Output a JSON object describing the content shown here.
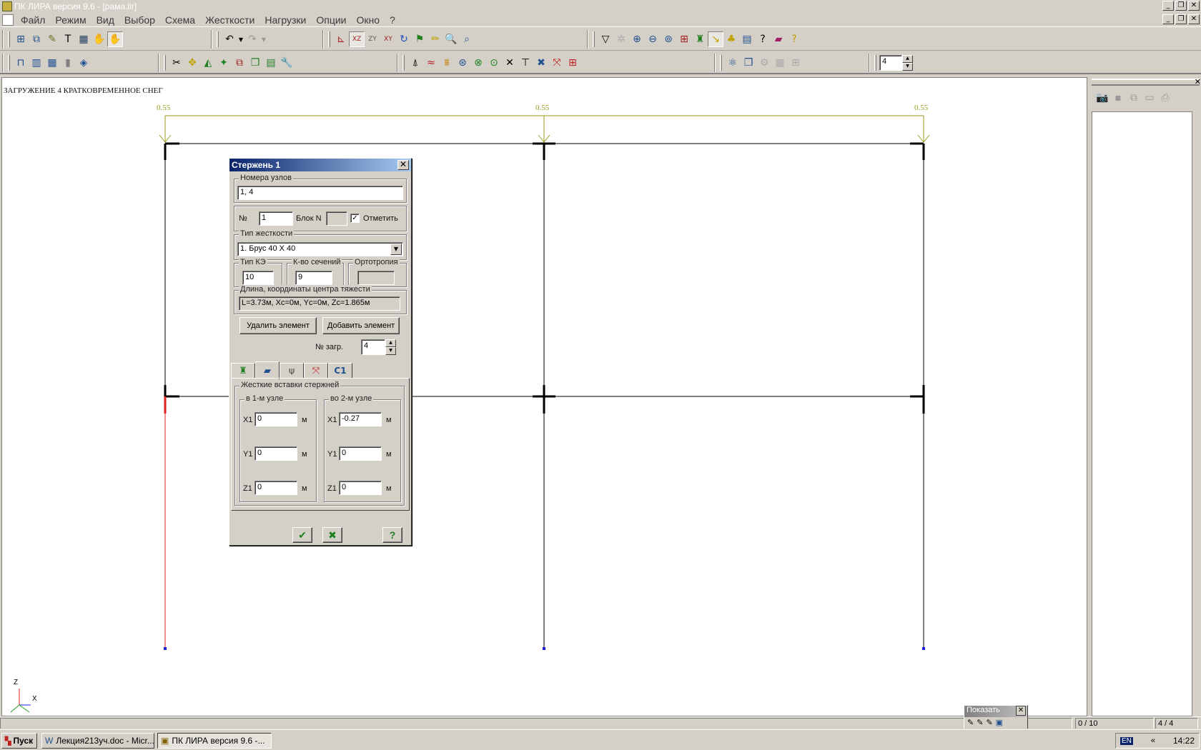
{
  "window": {
    "title": "ПК ЛИРА  версия 9.6 - [рама.lir]"
  },
  "menu": [
    "Файл",
    "Режим",
    "Вид",
    "Выбор",
    "Схема",
    "Жесткости",
    "Нагрузки",
    "Опции",
    "Окно",
    "?"
  ],
  "toolbar2": {
    "spin_value": "4"
  },
  "canvas": {
    "load_title": "ЗАГРУЖЕНИЕ 4 КРАТКОВРЕМЕННОЕ СНЕГ",
    "load_labels": [
      "0.55",
      "0.55",
      "0.55"
    ],
    "axis_z": "Z",
    "axis_x": "X"
  },
  "dialog": {
    "title": "Стержень  1",
    "nodes_legend": "Номера узлов",
    "nodes_value": "1, 4",
    "num_label": "№",
    "num_value": "1",
    "block_label": "Блок N",
    "mark_label": "Отметить",
    "mark_checked": true,
    "stiff_legend": "Тип жесткости",
    "stiff_value": "1. Брус 40 X 40",
    "fe_legend": "Тип КЭ",
    "fe_value": "10",
    "sections_legend": "К-во сечений",
    "sections_value": "9",
    "ortho_legend": "Ортотропия",
    "length_legend": "Длина, координаты центра тяжести",
    "length_value": "L=3.73м, Xc=0м, Yc=0м, Zc=1.865м",
    "delete_btn": "Удалить элемент",
    "add_btn": "Добавить элемент",
    "load_label": "№ загр.",
    "load_value": "4",
    "tab_c1": "С1",
    "rigid_legend": "Жесткие вставки стержней",
    "node1_legend": "в 1-м узле",
    "node2_legend": "во 2-м узле",
    "x1_label": "X1",
    "y1_label": "Y1",
    "z1_label": "Z1",
    "unit": "м",
    "node1": {
      "x1": "0",
      "y1": "0",
      "z1": "0"
    },
    "node2": {
      "x1": "-0.27",
      "y1": "0",
      "z1": "0"
    }
  },
  "status": {
    "cell1": "0 / 10",
    "cell2": "4 / 4"
  },
  "float_window": {
    "title": "Показать"
  },
  "taskbar": {
    "start": "Пуск",
    "items": [
      "Лекция213уч.doc - Micr...",
      "ПК ЛИРА  версия 9.6 -..."
    ],
    "lang": "EN",
    "time": "14:22"
  },
  "colors": {
    "load_color": "#9a9a20",
    "frame": "#000000",
    "selected": "#e02020",
    "support": "#2020e0",
    "title_grad_start": "#0a246a",
    "title_grad_end": "#a6caf0"
  }
}
